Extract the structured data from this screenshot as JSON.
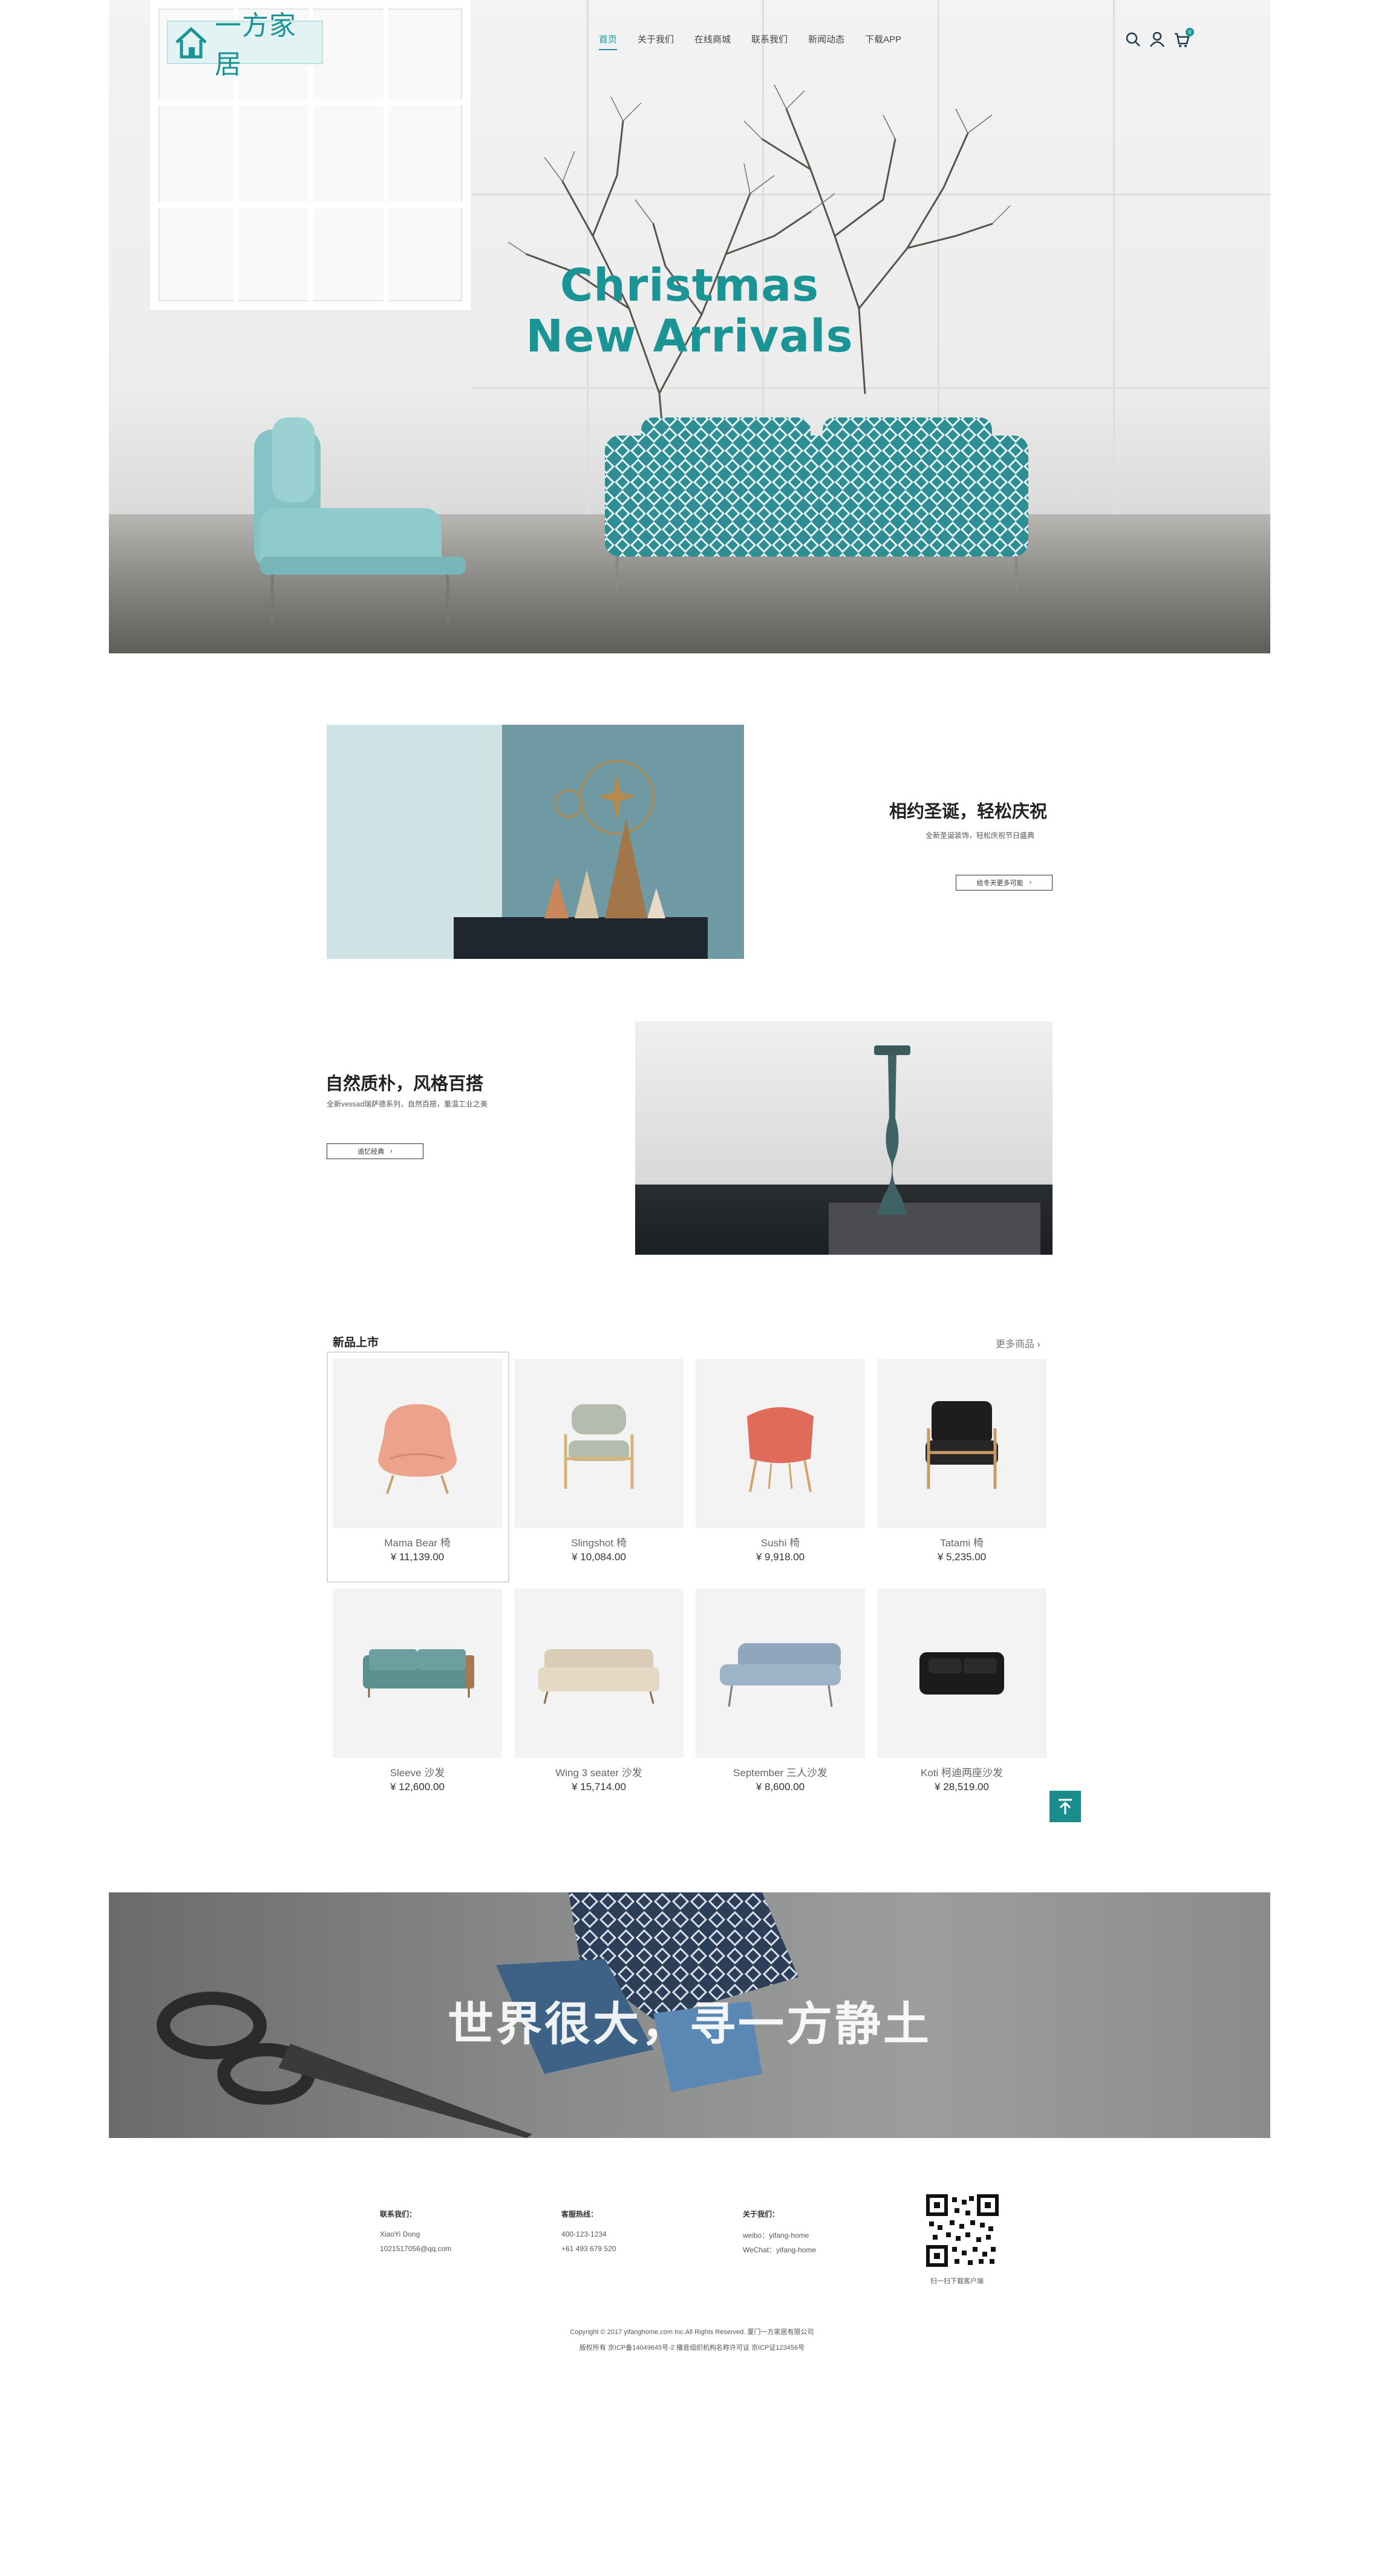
{
  "colors": {
    "accent": "#1a9494",
    "text": "#333333",
    "thumb_bg": "#f2f3f2"
  },
  "header": {
    "logo_text": "一方家居",
    "nav": [
      "首页",
      "关于我们",
      "在线商城",
      "联系我们",
      "新闻动态",
      "下载APP"
    ],
    "active_nav": "首页",
    "icons": [
      "search-icon",
      "user-icon",
      "cart-icon"
    ],
    "cart_count": "0"
  },
  "hero": {
    "title_line1": "Christmas",
    "title_line2": "New Arrivals"
  },
  "promo1": {
    "title": "相约圣诞，轻松庆祝",
    "subtitle": "全新圣诞装饰，轻松庆祝节日盛典",
    "button": "给冬天更多可能"
  },
  "promo2": {
    "title": "自然质朴，风格百搭",
    "subtitle": "全新vessad瑞萨德系列，自然百搭，重温工业之美",
    "button": "追忆经典"
  },
  "products": {
    "title": "新品上市",
    "more": "更多商品",
    "items": [
      {
        "name": "Mama Bear 椅",
        "price": "¥ 11,139.00"
      },
      {
        "name": "Slingshot 椅",
        "price": "¥ 10,084.00"
      },
      {
        "name": "Sushi 椅",
        "price": "¥ 9,918.00"
      },
      {
        "name": "Tatami 椅",
        "price": "¥ 5,235.00"
      },
      {
        "name": "Sleeve 沙发",
        "price": "¥ 12,600.00"
      },
      {
        "name": "Wing 3 seater 沙发",
        "price": "¥ 15,714.00"
      },
      {
        "name": "September 三人沙发",
        "price": "¥ 8,600.00"
      },
      {
        "name": "Koti 柯迪两座沙发",
        "price": "¥ 28,519.00"
      }
    ]
  },
  "banner": {
    "text": "世界很大，寻一方静土"
  },
  "footer": {
    "contact": {
      "title": "联系我们：",
      "lines": [
        "XiaoYi Dong",
        "1021517056@qq.com"
      ]
    },
    "hotline": {
      "title": "客服热线：",
      "lines": [
        "400-123-1234",
        "+61 493 679 520"
      ]
    },
    "about": {
      "title": "关于我们：",
      "lines": [
        "weibo：yifang-home",
        "WeChat：yifang-home"
      ]
    },
    "qr_caption": "扫一扫下载客户端",
    "copyright": "Copyright © 2017 yifanghome.com Inc.All Rights Reserved. 厦门一方家居有限公司",
    "icp": "版权所有 京ICP备14049645号-2 播音组织机构名称许可证  京ICP证123456号"
  }
}
